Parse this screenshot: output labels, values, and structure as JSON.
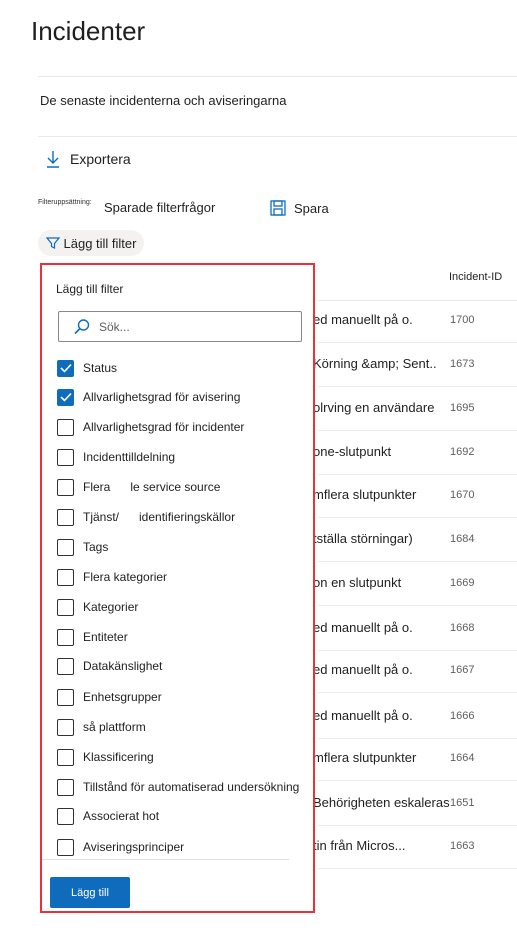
{
  "page": {
    "title": "Incidenter",
    "subtitle": "De senaste incidenterna och aviseringarna"
  },
  "toolbar": {
    "export_label": "Exportera",
    "filterset_label": "Filteruppsättning:",
    "saved_queries_label": "Sparade filterfrågor",
    "save_label": "Spara",
    "add_filter_label": "Lägg till filter"
  },
  "table": {
    "id_header": "Incident-ID",
    "rows": [
      {
        "name": "ed manuellt på o.",
        "id": "1700"
      },
      {
        "name": "Körning &amp; Sent..",
        "id": "1673"
      },
      {
        "name": "olrving en användare",
        "id": "1695"
      },
      {
        "name": "one-slutpunkt",
        "id": "1692"
      },
      {
        "name": "mflera slutpunkter",
        "id": "1670"
      },
      {
        "name": "tställa störningar)",
        "id": "1684"
      },
      {
        "name": "on en slutpunkt",
        "id": "1669"
      },
      {
        "name": "ed manuellt på o.",
        "id": "1668"
      },
      {
        "name": "ed manuellt på o.",
        "id": "1667"
      },
      {
        "name": "ed manuellt på o.",
        "id": "1666"
      },
      {
        "name": "mflera slutpunkter",
        "id": "1664"
      },
      {
        "name": "Behörigheten eskaleras",
        "id": "1651"
      },
      {
        "name": "tin från Micros...",
        "id": "1663"
      }
    ]
  },
  "filter_panel": {
    "title": "Lägg till filter",
    "search_text": "Sök...",
    "items": [
      {
        "label": "Status",
        "checked": true
      },
      {
        "label": "Allvarlighetsgrad för avisering",
        "checked": true
      },
      {
        "label": "Allvarlighetsgrad för incidenter",
        "checked": false
      },
      {
        "label": "Incidenttilldelning",
        "checked": false
      },
      {
        "label": "Flera      le service source",
        "checked": false
      },
      {
        "label": "Tjänst/      identifieringskällor",
        "checked": false
      },
      {
        "label": "Tags",
        "checked": false
      },
      {
        "label": "Flera kategorier",
        "checked": false
      },
      {
        "label": "Kategorier",
        "checked": false
      },
      {
        "label": "Entiteter",
        "checked": false
      },
      {
        "label": "Datakänslighet",
        "checked": false
      },
      {
        "label": "Enhetsgrupper",
        "checked": false
      },
      {
        "label": "så plattform",
        "checked": false
      },
      {
        "label": "Klassificering",
        "checked": false
      },
      {
        "label": "Tillstånd för automatiserad undersökning",
        "checked": false
      },
      {
        "label": "Associerat hot",
        "checked": false
      },
      {
        "label": "Aviseringsprinciper",
        "checked": false
      }
    ],
    "add_button_label": "Lägg till"
  },
  "colors": {
    "accent": "#0f6cbd",
    "highlight_border": "#e8333c"
  }
}
